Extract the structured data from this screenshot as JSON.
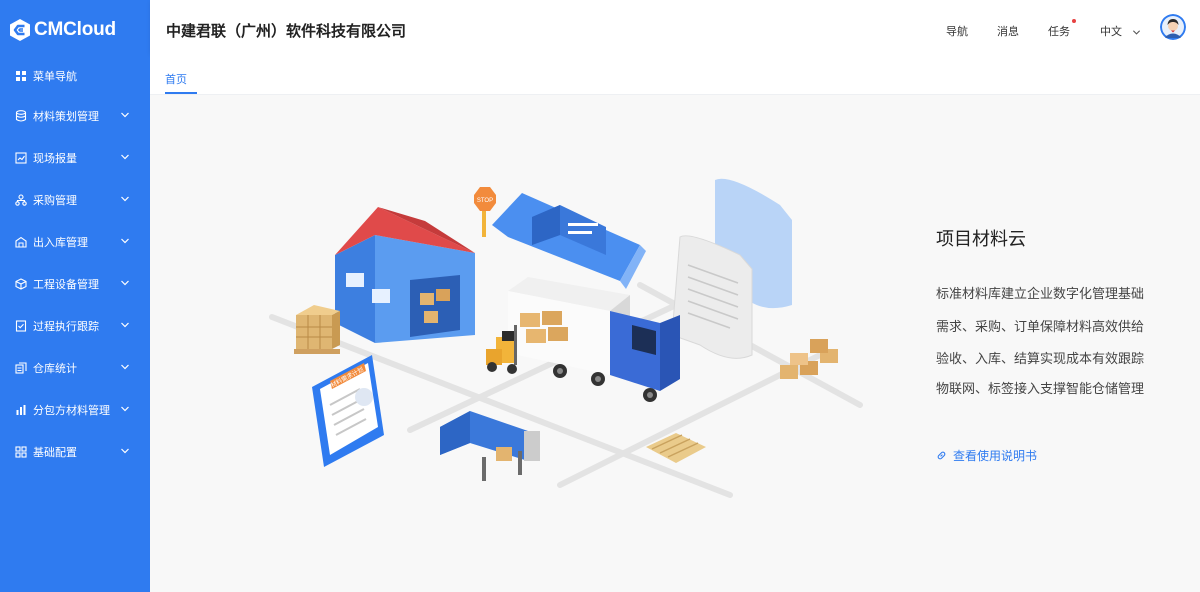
{
  "brand": {
    "logo_text": "CMCloud"
  },
  "sidebar": {
    "items": [
      {
        "label": "菜单导航",
        "icon": "grid-icon",
        "expandable": false
      },
      {
        "label": "材料策划管理",
        "icon": "database-icon",
        "expandable": true
      },
      {
        "label": "现场报量",
        "icon": "report-icon",
        "expandable": true
      },
      {
        "label": "采购管理",
        "icon": "org-icon",
        "expandable": true
      },
      {
        "label": "出入库管理",
        "icon": "warehouse-icon",
        "expandable": true
      },
      {
        "label": "工程设备管理",
        "icon": "cube-icon",
        "expandable": true
      },
      {
        "label": "过程执行跟踪",
        "icon": "checklist-icon",
        "expandable": true
      },
      {
        "label": "仓库统计",
        "icon": "stats-icon",
        "expandable": true
      },
      {
        "label": "分包方材料管理",
        "icon": "bar-chart-icon",
        "expandable": true
      },
      {
        "label": "基础配置",
        "icon": "apps-icon",
        "expandable": true
      }
    ]
  },
  "header": {
    "company": "中建君联（广州）软件科技有限公司",
    "nav": "导航",
    "messages": "消息",
    "tasks": "任务",
    "language": "中文"
  },
  "tabs": [
    {
      "label": "首页"
    }
  ],
  "main": {
    "title": "项目材料云",
    "description": [
      "标准材料库建立企业数字化管理基础",
      "需求、采购、订单保障材料高效供给",
      "验收、入库、结算实现成本有效跟踪",
      "物联网、标签接入支撑智能仓储管理"
    ],
    "manual_link": "查看使用说明书"
  },
  "illustration": {
    "stop_sign": "STOP",
    "clipboard_title": "材料需求计划"
  },
  "colors": {
    "sidebar": "#2f7bf0",
    "accent": "#2f7bf0",
    "content_bg": "#f8f8f8",
    "task_dot": "#e64141"
  }
}
